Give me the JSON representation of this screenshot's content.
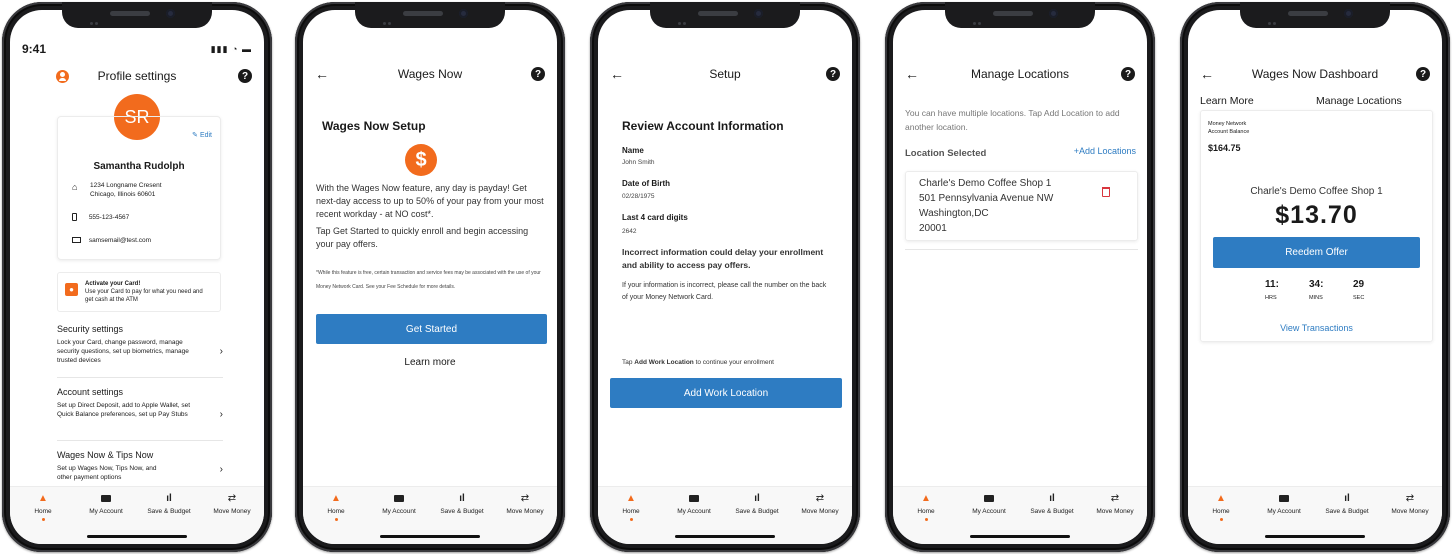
{
  "nav": {
    "tabs": [
      {
        "label": "Home",
        "icon": "home-icon"
      },
      {
        "label": "My Account",
        "icon": "card-icon"
      },
      {
        "label": "Save & Budget",
        "icon": "bar-chart-icon"
      },
      {
        "label": "Move Money",
        "icon": "transfer-icon"
      }
    ]
  },
  "profile": {
    "status_time": "9:41",
    "title": "Profile settings",
    "initials": "SR",
    "edit_label": "Edit",
    "name": "Samantha Rudolph",
    "address_line1": "1234 Longname Cresent",
    "address_line2": "Chicago, Illinois 60601",
    "phone": "555-123-4567",
    "email": "samsemail@test.com",
    "promo_title": "Activate your Card!",
    "promo_text": "Use your Card to pay for what you need and get cash at the ATM",
    "sections": [
      {
        "title": "Security settings",
        "desc": "Lock your Card, change password, manage security questions, set up biometrics, manage trusted devices"
      },
      {
        "title": "Account settings",
        "desc": "Set up Direct Deposit, add to Apple Wallet, set Quick Balance preferences, set up Pay Stubs"
      },
      {
        "title": "Wages Now & Tips Now",
        "desc": "Set up Wages Now, Tips Now, and other payment options"
      }
    ]
  },
  "wages_setup": {
    "header": "Wages Now",
    "heading": "Wages Now Setup",
    "para1": "With the Wages Now feature, any day is payday! Get next-day access to up to 50% of your pay from your most recent workday - at NO cost*.",
    "para2": "Tap Get Started to quickly enroll and begin accessing your pay offers.",
    "footnote": "*While this feature is free, certain transaction and service fees may be associated with the use of your Money Network Card. See your Fee Schedule for more details.",
    "cta": "Get Started",
    "learn_more": "Learn more"
  },
  "review": {
    "header": "Setup",
    "heading": "Review Account Information",
    "name_label": "Name",
    "name_value": "John Smith",
    "dob_label": "Date of Birth",
    "dob_value": "02/28/1975",
    "card_label": "Last 4 card digits",
    "card_value": "2642",
    "warning": "Incorrect information could delay your enrollment and ability to access pay offers.",
    "call_text": "If your information is incorrect, please call the number on the back of your Money Network Card.",
    "tap_prefix": "Tap",
    "tap_bold": "Add Work Location",
    "tap_suffix": "to continue your enrollment",
    "cta": "Add Work Location"
  },
  "locations": {
    "header": "Manage Locations",
    "intro": "You can have multiple locations. Tap Add Location to add another location.",
    "selected_label": "Location Selected",
    "add_label": "+Add Locations",
    "card_line1": "Charle's Demo Coffee Shop 1",
    "card_line2": "501 Pennsylvania Avenue NW",
    "card_line3": "Washington,DC",
    "card_line4": "20001"
  },
  "dashboard": {
    "header": "Wages Now Dashboard",
    "learn_more": "Learn More",
    "manage_locations": "Manage Locations",
    "balance_label1": "Money Network",
    "balance_label2": "Account Balance",
    "balance": "$164.75",
    "shop": "Charle's Demo Coffee Shop 1",
    "offer": "$13.70",
    "cta": "Reedem Offer",
    "hrs": "11:",
    "hrs_label": "HRS",
    "mins": "34:",
    "mins_label": "MINS",
    "secs": "29",
    "secs_label": "SEC",
    "view_tx": "View Transactions"
  },
  "colors": {
    "accent": "#f26b1d",
    "primary_blue": "#2e7cc2",
    "delete_red": "#d9363e"
  }
}
